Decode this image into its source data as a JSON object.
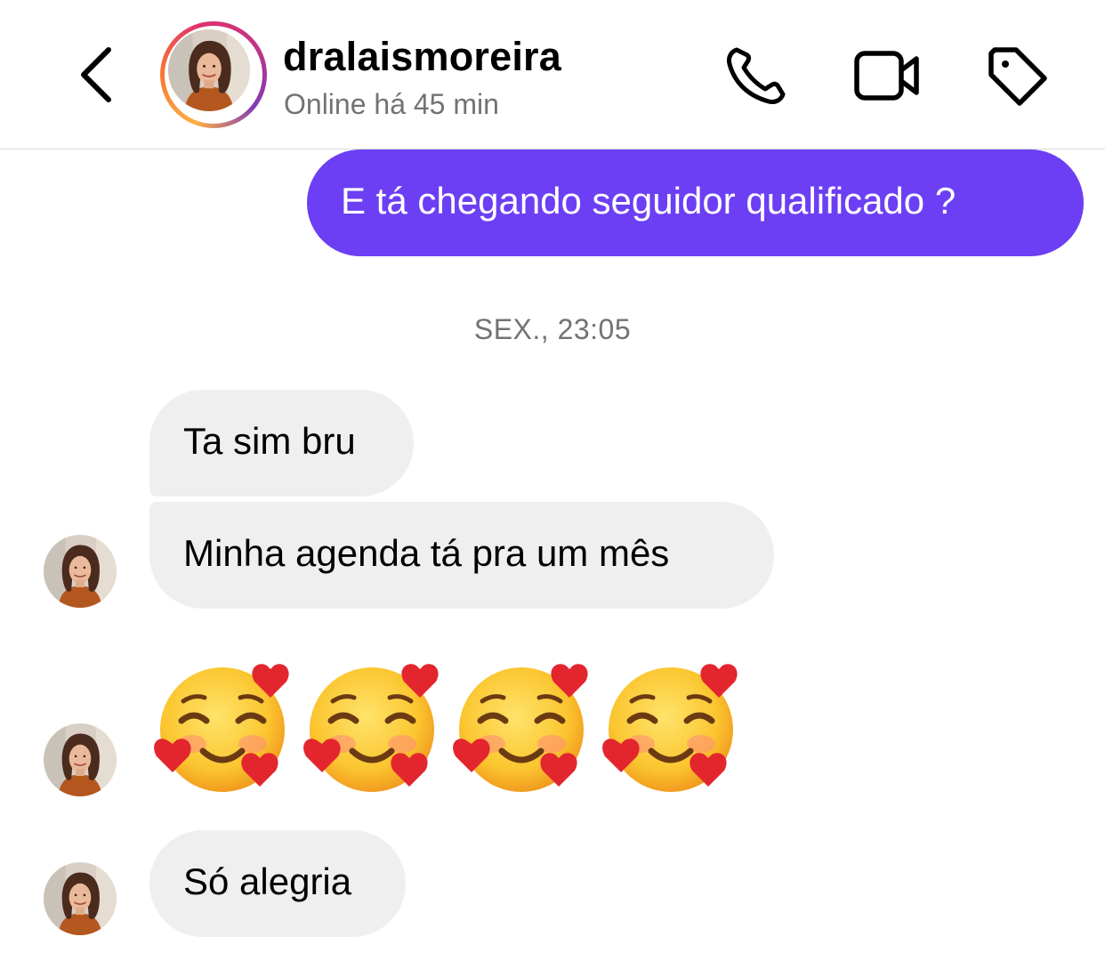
{
  "header": {
    "username": "dralaismoreira",
    "status": "Online há 45 min",
    "icons": {
      "back": "chevron-left-icon",
      "phone": "phone-icon",
      "video": "video-camera-icon",
      "tag": "tag-icon"
    }
  },
  "messages": {
    "outgoing": [
      {
        "text": "E tá chegando seguidor qualificado ?"
      }
    ],
    "timestamp": "SEX., 23:05",
    "incoming": [
      {
        "text": "Ta sim bru"
      },
      {
        "text": "Minha agenda tá pra um mês"
      },
      {
        "text": "Só alegria"
      }
    ],
    "emoji_message": {
      "emoji": "smiling-face-with-hearts",
      "count": 4
    }
  },
  "colors": {
    "outgoing_bubble": "#6c3ff4",
    "incoming_bubble": "#efefef",
    "secondary_text": "#737373"
  }
}
